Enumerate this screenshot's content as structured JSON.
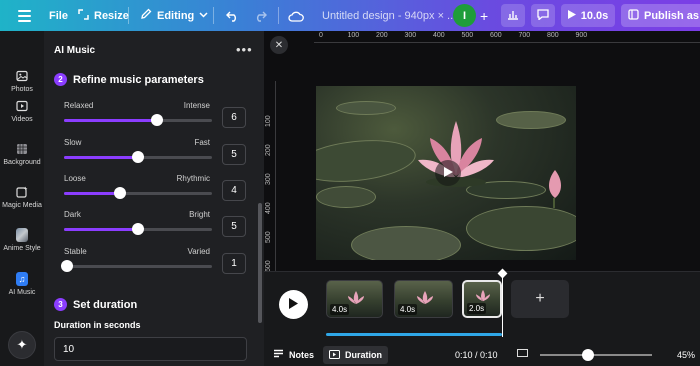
{
  "topbar": {
    "file_label": "File",
    "resize_label": "Resize",
    "editing_label": "Editing",
    "design_title": "Untitled design - 940px × ...",
    "avatar_initial": "I",
    "play_duration": "10.0s",
    "publish_label": "Publish as Br"
  },
  "rail": {
    "items": [
      {
        "label": "Photos",
        "icon": "photo-icon"
      },
      {
        "label": "Videos",
        "icon": "video-icon"
      },
      {
        "label": "Background",
        "icon": "pattern-icon"
      },
      {
        "label": "Magic Media",
        "icon": "magic-media-icon"
      },
      {
        "label": "Anime Style",
        "icon": "anime-style-icon"
      },
      {
        "label": "AI Music",
        "icon": "music-icon"
      }
    ]
  },
  "panel": {
    "title": "AI Music",
    "more": "•••",
    "step2_num": "2",
    "step2_label": "Refine music parameters",
    "sliders": [
      {
        "left": "Relaxed",
        "right": "Intense",
        "value": "6",
        "position": 0.63
      },
      {
        "left": "Slow",
        "right": "Fast",
        "value": "5",
        "position": 0.5
      },
      {
        "left": "Loose",
        "right": "Rhythmic",
        "value": "4",
        "position": 0.38
      },
      {
        "left": "Dark",
        "right": "Bright",
        "value": "5",
        "position": 0.5
      },
      {
        "left": "Stable",
        "right": "Varied",
        "value": "1",
        "position": 0.0
      }
    ],
    "step3_num": "3",
    "step3_label": "Set duration",
    "duration_label": "Duration in seconds",
    "duration_value": "10"
  },
  "canvas": {
    "ruler_top": [
      "0",
      "100",
      "200",
      "300",
      "400",
      "500",
      "600",
      "700",
      "800",
      "900"
    ],
    "ruler_left": [
      "100",
      "200",
      "300",
      "400",
      "500",
      "600"
    ]
  },
  "timeline": {
    "clips": [
      {
        "label": "4.0s"
      },
      {
        "label": "4.0s"
      },
      {
        "label": "2.0s"
      }
    ],
    "add_label": "+"
  },
  "bottombar": {
    "notes_label": "Notes",
    "duration_label": "Duration",
    "time": "0:10 / 0:10",
    "zoom": "45%"
  },
  "colors": {
    "accent": "#8b3dff",
    "audio": "#2fa7e8"
  }
}
